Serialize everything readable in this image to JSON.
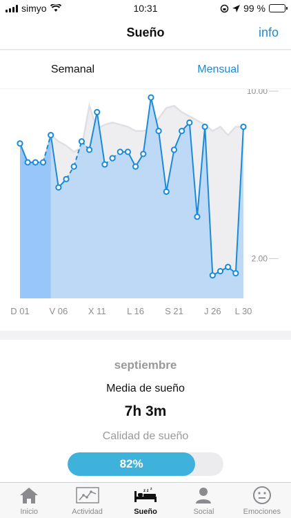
{
  "status": {
    "carrier": "simyo",
    "time": "10:31",
    "battery": "99 %"
  },
  "header": {
    "title": "Sueño",
    "info": "info"
  },
  "segments": {
    "weekly": "Semanal",
    "monthly": "Mensual",
    "active": "monthly"
  },
  "chart_data": {
    "type": "area",
    "x_tick_labels": [
      "D 01",
      "V 06",
      "X 11",
      "L 16",
      "S 21",
      "J 26",
      "L 30"
    ],
    "x_tick_positions": [
      1,
      6,
      11,
      16,
      21,
      26,
      30
    ],
    "y_tick_labels": [
      "10.00",
      "2.00"
    ],
    "y_tick_values": [
      10,
      2
    ],
    "ylim": [
      0,
      10
    ],
    "series": [
      {
        "x": [
          1,
          2,
          3,
          4,
          5,
          6,
          7,
          8,
          9,
          10,
          11,
          12,
          13,
          14,
          15,
          16,
          17,
          18,
          19,
          20,
          21,
          22,
          23,
          24,
          25,
          26,
          27,
          28,
          29,
          30
        ],
        "values": [
          7.4,
          6.5,
          6.5,
          6.5,
          7.8,
          5.3,
          5.7,
          6.3,
          7.5,
          7.1,
          8.9,
          6.4,
          6.7,
          7.0,
          7.0,
          6.3,
          6.9,
          9.6,
          8.0,
          5.1,
          7.1,
          8.0,
          8.4,
          3.9,
          8.2,
          1.1,
          1.3,
          1.5,
          1.2,
          8.2
        ]
      },
      {
        "x": [
          1,
          2,
          3,
          4,
          5,
          6,
          7,
          8,
          9,
          10,
          11,
          12,
          13,
          14,
          15,
          16,
          17,
          18,
          19,
          20,
          21,
          22,
          23,
          24,
          25,
          26,
          27,
          28,
          29,
          30
        ],
        "values": [
          7.4,
          6.5,
          6.5,
          6.5,
          7.8,
          7.5,
          7.3,
          7.0,
          7.2,
          9.2,
          8.1,
          8.3,
          8.4,
          8.3,
          8.2,
          8.0,
          8.0,
          8.1,
          8.6,
          9.1,
          9.2,
          8.9,
          8.7,
          8.5,
          8.3,
          8.0,
          8.2,
          7.8,
          8.2,
          8.2
        ]
      }
    ]
  },
  "summary": {
    "month": "septiembre",
    "avg_label": "Media de sueño",
    "avg_value": "7h 3m",
    "quality_label": "Calidad de sueño",
    "quality_value": "82%",
    "quality_fraction": 0.82
  },
  "tabs": [
    {
      "label": "Inicio",
      "icon": "home-icon"
    },
    {
      "label": "Actividad",
      "icon": "activity-chart-icon"
    },
    {
      "label": "Sueño",
      "icon": "bed-icon"
    },
    {
      "label": "Social",
      "icon": "person-icon"
    },
    {
      "label": "Emociones",
      "icon": "smiley-icon"
    }
  ],
  "colors": {
    "accent": "#1a8ad8",
    "area": "#b9d7f5",
    "area_dark": "#99c6fa",
    "bar": "#3fb2dc"
  }
}
